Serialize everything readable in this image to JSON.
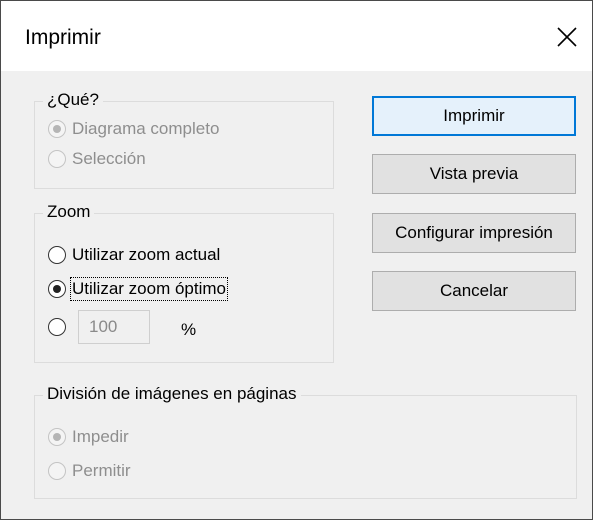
{
  "window": {
    "title": "Imprimir"
  },
  "que": {
    "legend": "¿Qué?",
    "options": [
      {
        "label": "Diagrama completo",
        "checked": true,
        "disabled": true
      },
      {
        "label": "Selección",
        "checked": false,
        "disabled": true
      }
    ]
  },
  "zoom": {
    "legend": "Zoom",
    "options": [
      {
        "label": "Utilizar zoom actual",
        "checked": false
      },
      {
        "label": "Utilizar zoom óptimo",
        "checked": true
      },
      {
        "label": "",
        "checked": false
      }
    ],
    "value": "100",
    "unit": "%"
  },
  "division": {
    "legend": "División de imágenes en páginas",
    "options": [
      {
        "label": "Impedir",
        "checked": true,
        "disabled": true
      },
      {
        "label": "Permitir",
        "checked": false,
        "disabled": true
      }
    ]
  },
  "buttons": {
    "print": "Imprimir",
    "preview": "Vista previa",
    "setup": "Configurar impresión",
    "cancel": "Cancelar"
  },
  "colors": {
    "default_button_border": "#0078d7",
    "disabled_text": "#8e8e8e"
  }
}
